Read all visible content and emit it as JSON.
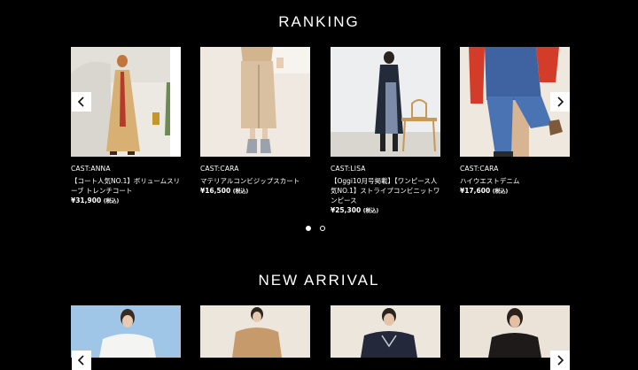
{
  "ranking": {
    "title": "RANKING",
    "products": [
      {
        "cast": "CAST:ANNA",
        "name": "【コート人気NO.1】ボリュームスリーブ トレンチコート",
        "price": "¥31,900",
        "tax": "(税込)"
      },
      {
        "cast": "CAST:CARA",
        "name": "マテリアルコンビジップスカート",
        "price": "¥16,500",
        "tax": "(税込)"
      },
      {
        "cast": "CAST:LISA",
        "name": "【Oggi10月号掲載】【ワンピース人気NO.1】ストライプコンビニットワンピース",
        "price": "¥25,300",
        "tax": "(税込)"
      },
      {
        "cast": "CAST:CARA",
        "name": "ハイウエストデニム",
        "price": "¥17,600",
        "tax": "(税込)"
      }
    ],
    "pagination": {
      "pages": 2,
      "active": 1
    }
  },
  "new_arrival": {
    "title": "NEW ARRIVAL"
  },
  "icons": {
    "prev": "chevron-left-icon",
    "next": "chevron-right-icon"
  },
  "colors": {
    "background": "#000000",
    "text": "#ffffff"
  }
}
